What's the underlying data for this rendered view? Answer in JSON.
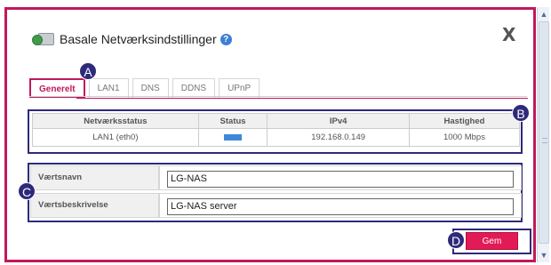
{
  "dialog": {
    "title": "Basale Netværksindstillinger",
    "help_icon": "?",
    "close_label": "X"
  },
  "tabs": [
    {
      "label": "Generelt",
      "active": true
    },
    {
      "label": "LAN1",
      "active": false
    },
    {
      "label": "DNS",
      "active": false
    },
    {
      "label": "DDNS",
      "active": false
    },
    {
      "label": "UPnP",
      "active": false
    }
  ],
  "status_table": {
    "headers": [
      "Netværksstatus",
      "Status",
      "IPv4",
      "Hastighed"
    ],
    "rows": [
      {
        "name": "LAN1 (eth0)",
        "status": "connected",
        "ipv4": "192.168.0.149",
        "speed": "1000 Mbps"
      }
    ]
  },
  "form": {
    "hostname_label": "Værtsnavn",
    "hostname_value": "LG-NAS",
    "description_label": "Værtsbeskrivelse",
    "description_value": "LG-NAS server"
  },
  "actions": {
    "save_label": "Gem"
  },
  "callouts": [
    "A",
    "B",
    "C",
    "D"
  ],
  "icons": {
    "app_icon": "nas-globe-icon",
    "help_icon": "question-icon",
    "close_icon": "close-icon",
    "status_icon": "link-status-bar"
  },
  "colors": {
    "accent": "#c2185b",
    "save_button": "#e21a56",
    "callout": "#2e2a7a",
    "status_bar": "#3f88d8"
  }
}
